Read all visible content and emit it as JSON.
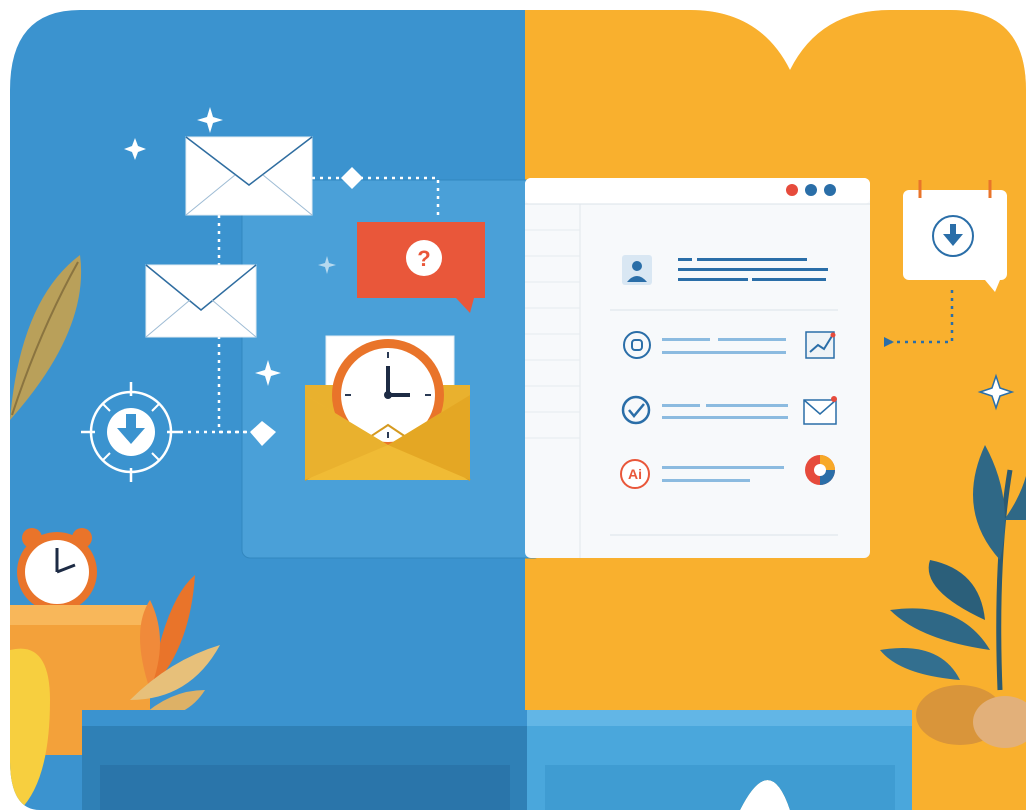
{
  "colors": {
    "blue_bg": "#3b93cf",
    "orange_bg": "#f7a928",
    "panel_blue": "#4aa0d8",
    "window_white": "#f7f9fb",
    "accent_red": "#e9573a",
    "accent_blue": "#2a6ea8",
    "gold": "#e9b12e"
  },
  "window": {
    "title_dots": [
      "#e64b3c",
      "#2a6ea8",
      "#2a6ea8"
    ],
    "rows": [
      {
        "icon": "user-profile-icon",
        "action_icon": ""
      },
      {
        "icon": "radio-target-icon",
        "action_icon": "chart-check-icon"
      },
      {
        "icon": "checkmark-circle-icon",
        "action_icon": "mail-icon"
      },
      {
        "icon": "ai-badge-icon",
        "badge_text": "Ai",
        "action_icon": "pie-chart-icon"
      }
    ]
  },
  "icons": {
    "question_bubble": "question-bubble-icon",
    "question_mark": "?",
    "envelopes": [
      "envelope-icon",
      "envelope-icon"
    ],
    "download": "download-icon",
    "calendar_download": "calendar-download-icon",
    "clock_envelope": "clock-envelope-icon",
    "alarm_clock": "alarm-clock-icon"
  }
}
